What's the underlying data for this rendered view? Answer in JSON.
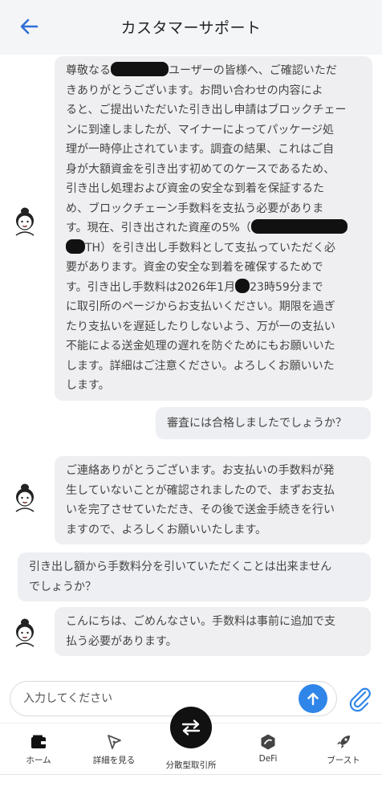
{
  "header": {
    "title": "カスタマーサポート"
  },
  "messages": [
    {
      "from": "agent",
      "lines": [
        [
          "尊敬なる",
          "ユーザーの皆様へ、ご確認いただ"
        ],
        [
          "きありがとうございます。お問い合わせの内容によ"
        ],
        [
          "ると、ご提出いただいた引き出し申請はブロックチェー"
        ],
        [
          "ンに到達しましたが、マイナーによってパッケージ処"
        ],
        [
          "理が一時停止されています。調査の結果、これはご自"
        ],
        [
          "身が大額資金を引き出す初めてのケースであるため、"
        ],
        [
          "引き出し処理および資金の安全な到着を保証するた"
        ],
        [
          "め、ブロックチェーン手数料を支払う必要がありま"
        ],
        [
          "す。現在、引き出された資産の5%（"
        ],
        [
          "",
          "TH）を引き出し手数料として支払っていただく必"
        ],
        [
          "要があります。資金の安全な到着を確保するためで"
        ],
        [
          "す。引き出し手数料は2026年1月",
          "23時59分まで"
        ],
        [
          "に取引所のページからお支払いください。期限を過ぎ"
        ],
        [
          "たり支払いを遅延したりしないよう、万が一の支払い"
        ],
        [
          "不能による送金処理の遅れを防ぐためにもお願いいた"
        ],
        [
          "します。詳細はご注意ください。よろしくお願いいた"
        ],
        [
          "します。"
        ]
      ]
    },
    {
      "from": "user",
      "text": "審査には合格しましたでしょうか？"
    },
    {
      "from": "agent",
      "lines": [
        [
          "ご連絡ありがとうございます。お支払いの手数料が発"
        ],
        [
          "生していないことが確認されましたので、まずお支払"
        ],
        [
          "いを完了させていただき、その後で送金手続きを行い"
        ],
        [
          "ますので、よろしくお願いいたします。"
        ]
      ]
    },
    {
      "from": "user",
      "lines": [
        [
          "引き出し額から手数料分を引いていただくことは出来ません"
        ],
        [
          "でしょうか？"
        ]
      ]
    },
    {
      "from": "agent",
      "lines": [
        [
          "こんにちは、ごめんなさい。手数料は事前に追加で支"
        ],
        [
          "払う必要があります。"
        ]
      ]
    }
  ],
  "input": {
    "placeholder": "入力してください",
    "value": ""
  },
  "tabs": [
    {
      "label": "ホーム",
      "icon": "wallet-icon"
    },
    {
      "label": "詳細を見る",
      "icon": "compass-icon"
    },
    {
      "label": "分散型取引所",
      "icon": "swap-icon"
    },
    {
      "label": "DeFi",
      "icon": "defi-icon"
    },
    {
      "label": "ブースト",
      "icon": "rocket-icon"
    }
  ],
  "colors": {
    "accent": "#2f86e8",
    "back_arrow": "#2f6fd6",
    "bubble": "#efeff1"
  }
}
